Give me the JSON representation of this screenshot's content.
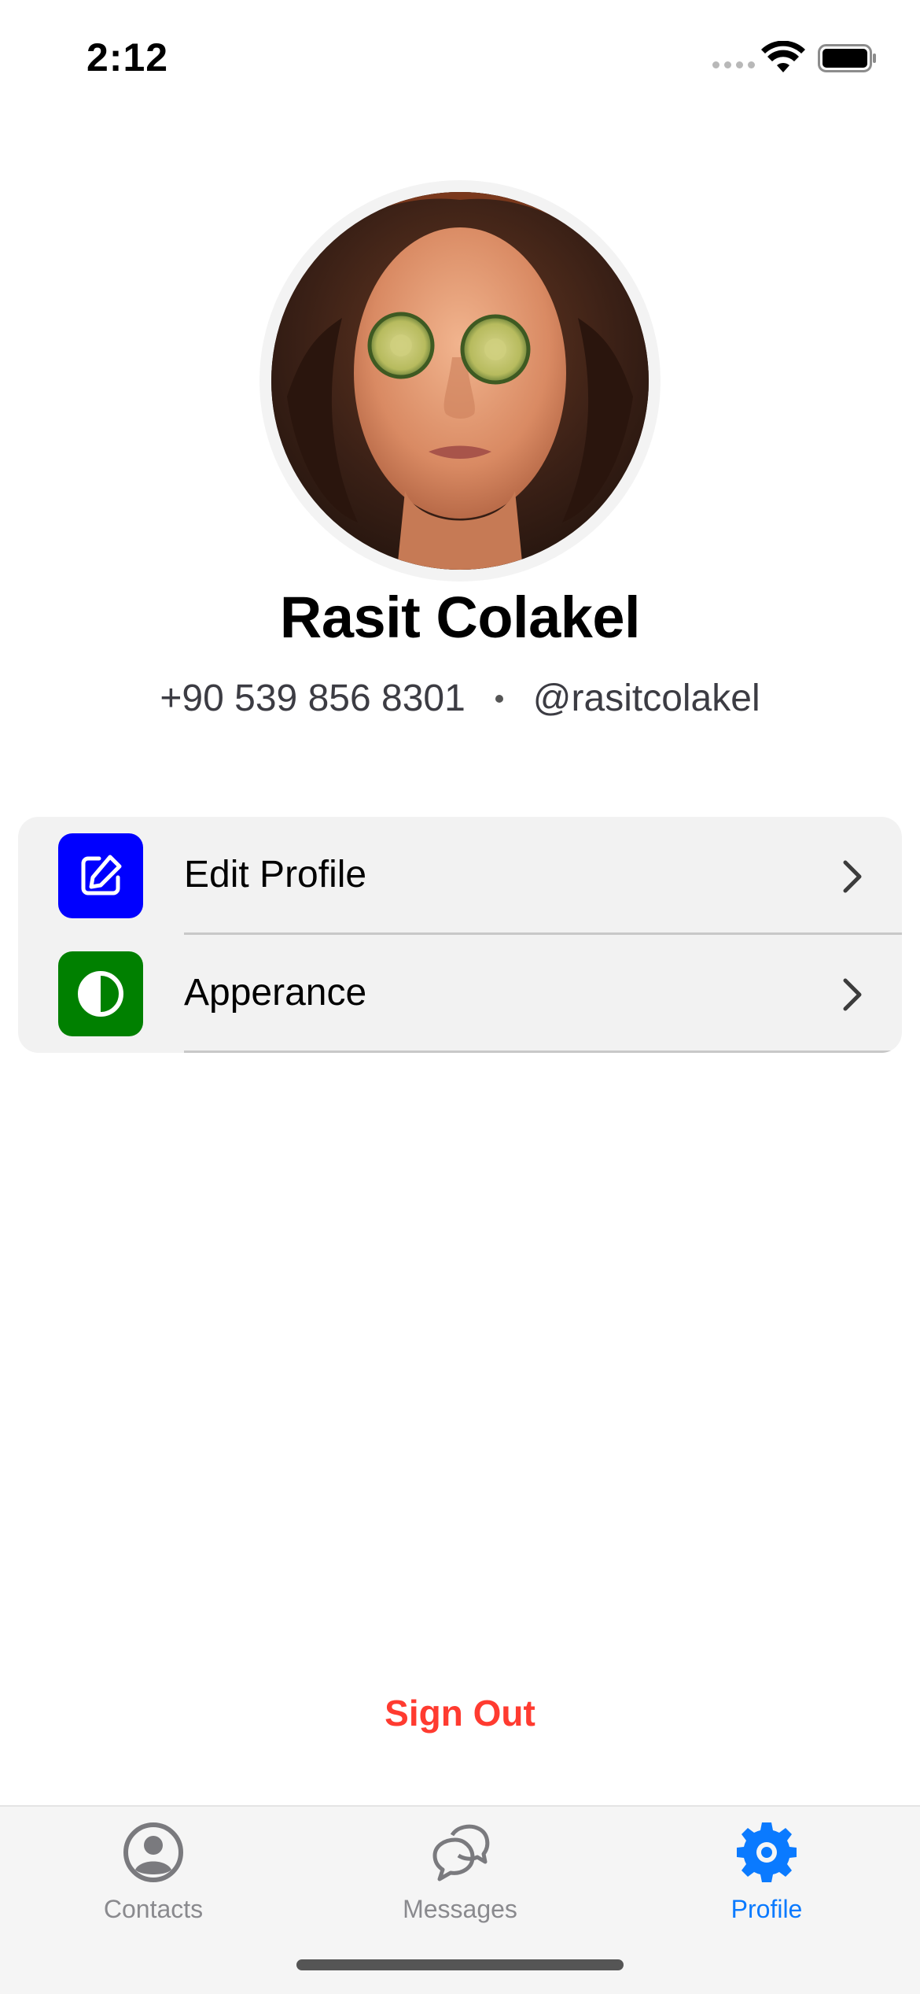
{
  "status_bar": {
    "time": "2:12",
    "icons": [
      "cellular-signal-icon",
      "wifi-icon",
      "battery-icon"
    ]
  },
  "profile": {
    "name": "Rasit Colakel",
    "phone": "+90 539 856 8301",
    "username": "@rasitcolakel",
    "avatar_icon": "profile-photo"
  },
  "settings": {
    "items": [
      {
        "label": "Edit Profile",
        "icon": "edit-icon",
        "icon_bg": "#0000ff"
      },
      {
        "label": "Apperance",
        "icon": "contrast-icon",
        "icon_bg": "#008000"
      }
    ]
  },
  "actions": {
    "sign_out_label": "Sign Out",
    "sign_out_color": "#ff3b30"
  },
  "tab_bar": {
    "active_color": "#0a7aff",
    "inactive_color": "#8a8a8e",
    "tabs": [
      {
        "label": "Contacts",
        "icon": "person-circle-icon",
        "active": false
      },
      {
        "label": "Messages",
        "icon": "chat-bubbles-icon",
        "active": false
      },
      {
        "label": "Profile",
        "icon": "gear-icon",
        "active": true
      }
    ]
  }
}
